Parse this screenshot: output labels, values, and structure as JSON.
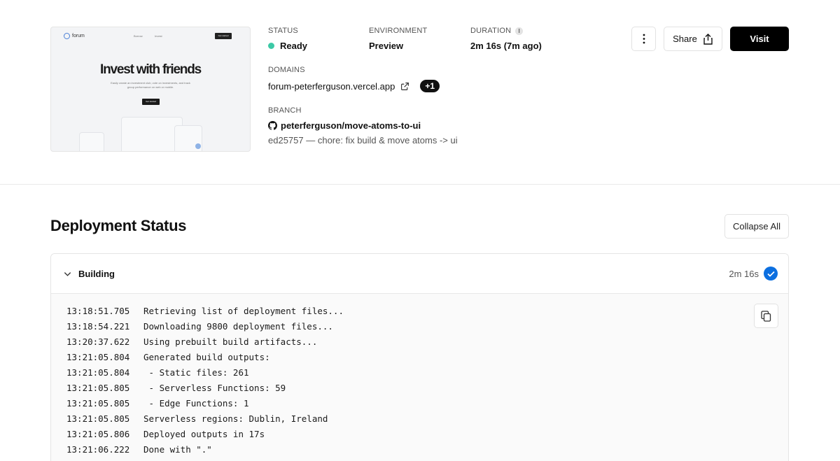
{
  "preview": {
    "brand": "forum",
    "nav": [
      "Borrow",
      "Invest",
      "Lend"
    ],
    "nav_button": "Get started",
    "headline": "Invest with friends",
    "subtext": "Easily create an investment club, vote on investments, and track group performance on web or mobile.",
    "cta": "Get started"
  },
  "status": {
    "label": "STATUS",
    "value": "Ready",
    "color": "#3cc9a6"
  },
  "environment": {
    "label": "ENVIRONMENT",
    "value": "Preview"
  },
  "duration": {
    "label": "DURATION",
    "value": "2m 16s (7m ago)"
  },
  "domains": {
    "label": "DOMAINS",
    "value": "forum-peterferguson.vercel.app",
    "extra": "+1"
  },
  "branch": {
    "label": "BRANCH",
    "name": "peterferguson/move-atoms-to-ui",
    "commit": "ed25757 — chore: fix build & move atoms -> ui"
  },
  "actions": {
    "more_icon": "vertical-ellipsis-icon",
    "share": "Share",
    "visit": "Visit"
  },
  "deployment_status": {
    "title": "Deployment Status",
    "collapse_all": "Collapse All",
    "step": {
      "title": "Building",
      "time": "2m 16s",
      "state": "complete",
      "accent": "#0b6fe0"
    },
    "log": [
      {
        "time": "13:18:51.705",
        "msg": "Retrieving list of deployment files..."
      },
      {
        "time": "13:18:54.221",
        "msg": "Downloading 9800 deployment files..."
      },
      {
        "time": "13:20:37.622",
        "msg": "Using prebuilt build artifacts..."
      },
      {
        "time": "13:21:05.804",
        "msg": "Generated build outputs:"
      },
      {
        "time": "13:21:05.804",
        "msg": " - Static files: 261"
      },
      {
        "time": "13:21:05.805",
        "msg": " - Serverless Functions: 59"
      },
      {
        "time": "13:21:05.805",
        "msg": " - Edge Functions: 1"
      },
      {
        "time": "13:21:05.805",
        "msg": "Serverless regions: Dublin, Ireland"
      },
      {
        "time": "13:21:05.806",
        "msg": "Deployed outputs in 17s"
      },
      {
        "time": "13:21:06.222",
        "msg": "Done with \".\""
      }
    ]
  }
}
